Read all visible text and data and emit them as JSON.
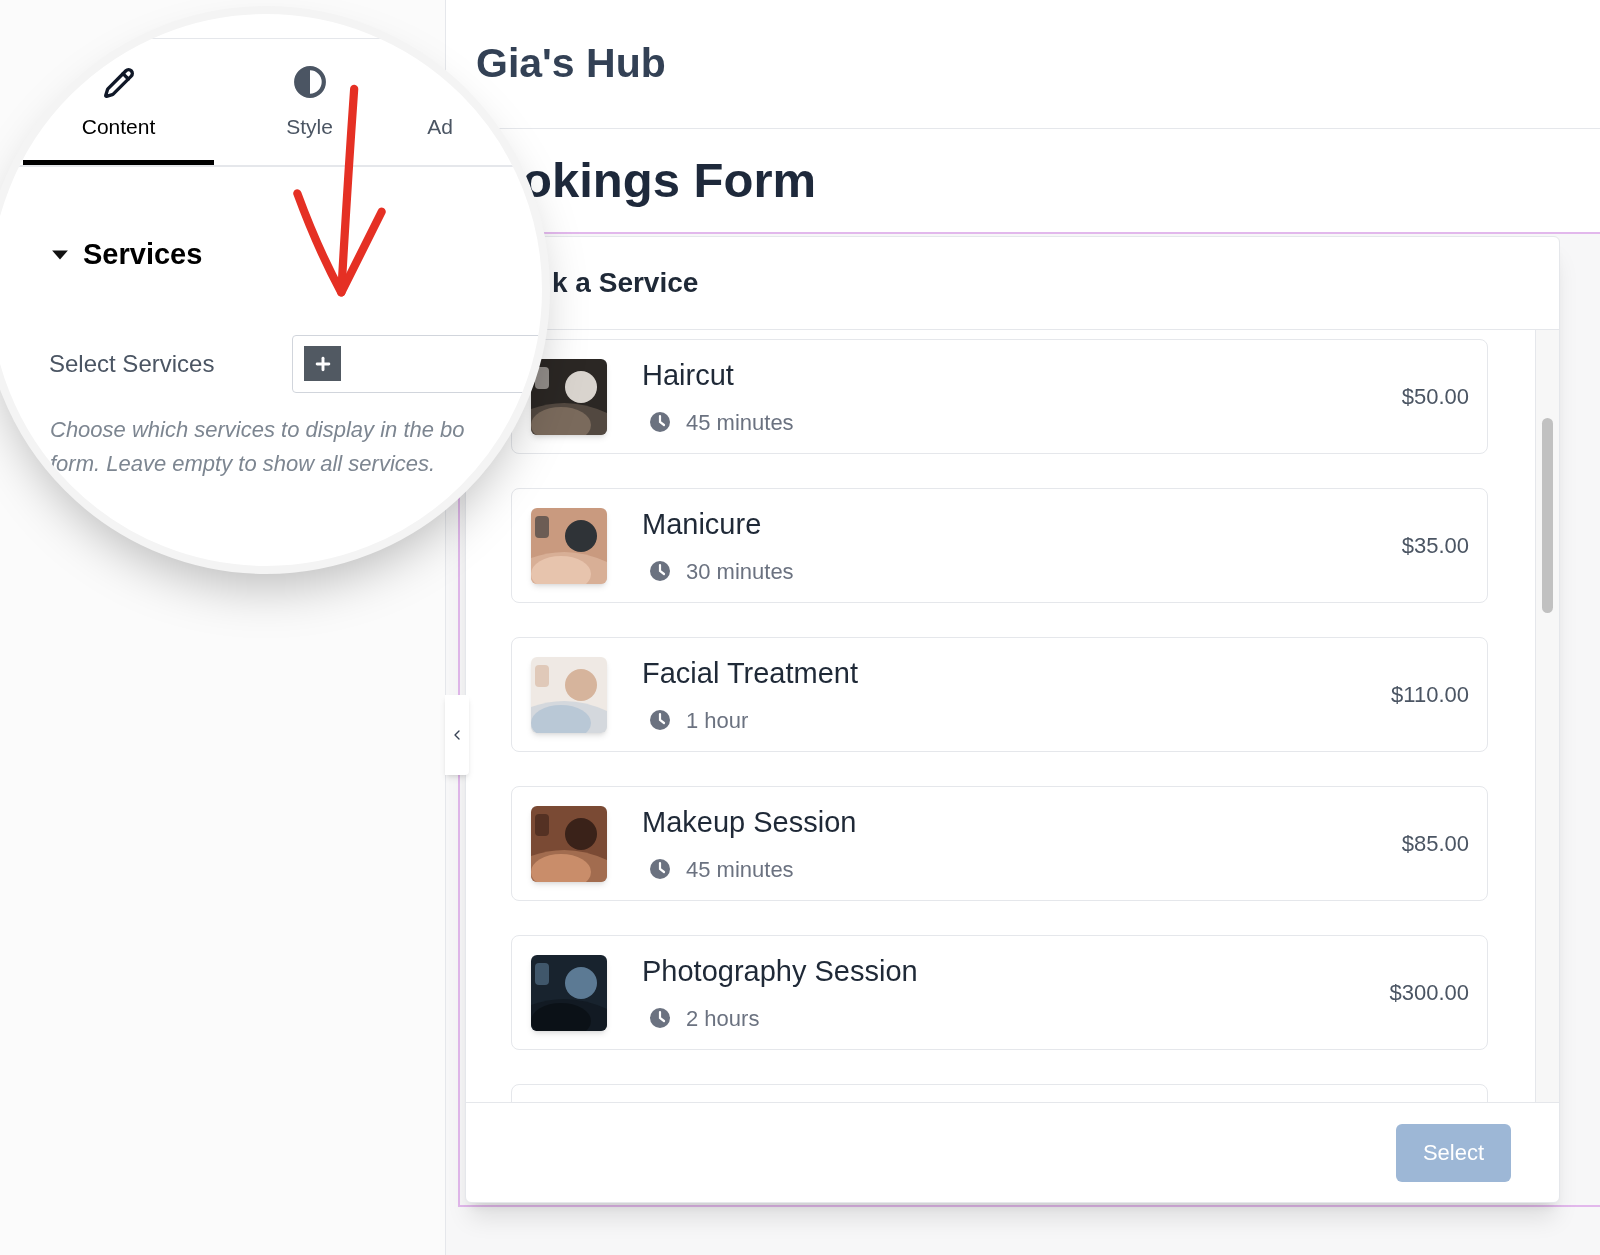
{
  "panel": {
    "tabs": [
      {
        "label": "Content",
        "selected": true
      },
      {
        "label": "Style",
        "selected": false
      },
      {
        "label": "Ad",
        "selected": false
      }
    ],
    "section": {
      "title": "Services",
      "expanded": true
    },
    "field": {
      "label": "Select Services"
    },
    "help_lines": [
      "Choose which services to display in the bo",
      "form. Leave empty to show all services."
    ]
  },
  "site_title": "Gia's Hub",
  "page_title": "okings Form",
  "form": {
    "title": "k a Service",
    "services": [
      {
        "name": "Haircut",
        "duration": "45 minutes",
        "price": "$50.00"
      },
      {
        "name": "Manicure",
        "duration": "30 minutes",
        "price": "$35.00"
      },
      {
        "name": "Facial Treatment",
        "duration": "1 hour",
        "price": "$110.00"
      },
      {
        "name": "Makeup Session",
        "duration": "45 minutes",
        "price": "$85.00"
      },
      {
        "name": "Photography Session",
        "duration": "2 hours",
        "price": "$300.00"
      }
    ],
    "button": {
      "label": "Select",
      "disabled": true
    }
  }
}
